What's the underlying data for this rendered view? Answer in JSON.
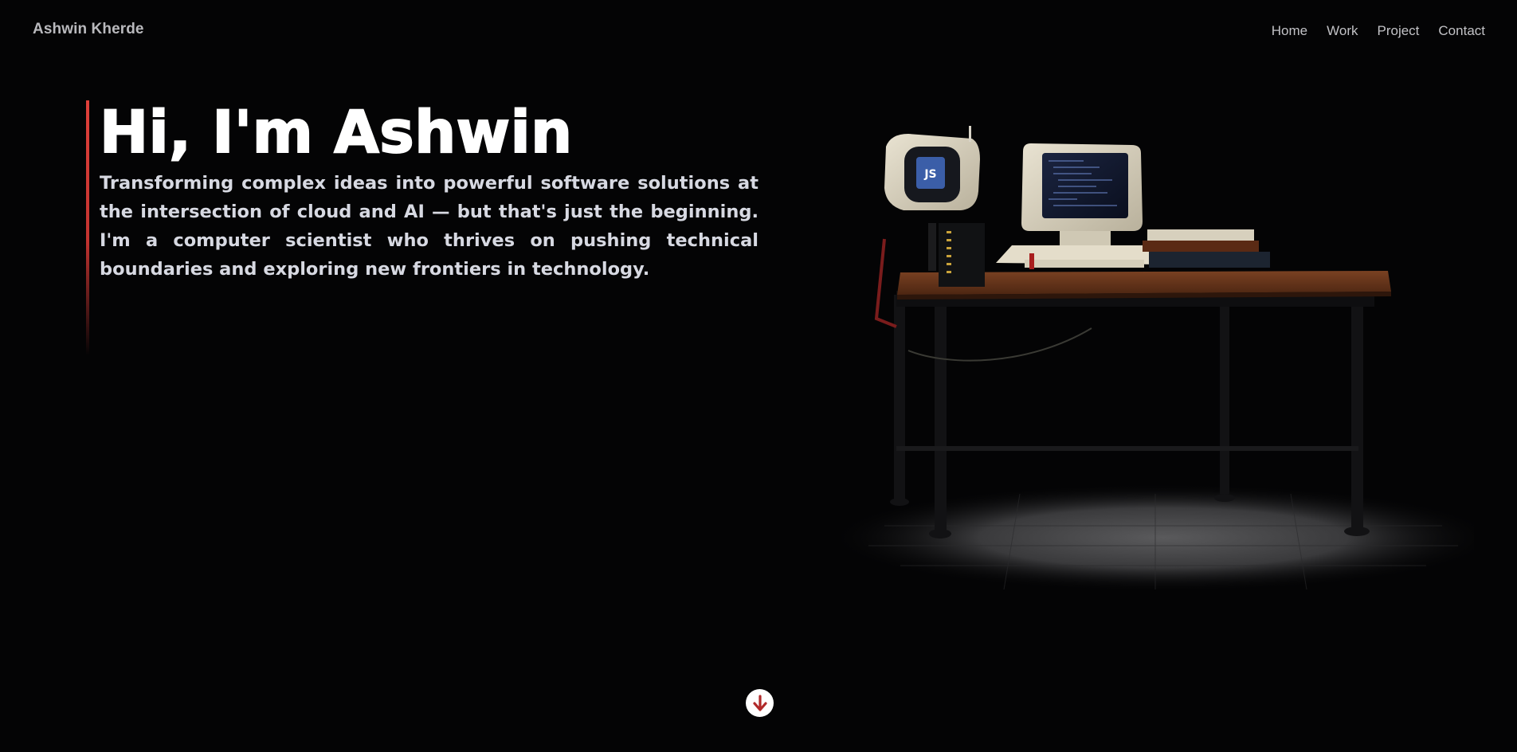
{
  "header": {
    "brand": "Ashwin Kherde",
    "nav": [
      "Home",
      "Work",
      "Project",
      "Contact"
    ]
  },
  "hero": {
    "title": "Hi, I'm Ashwin",
    "subtitle": "Transforming complex ideas into powerful software solutions at the intersection of cloud and AI — but that's just the beginning. I'm a computer scientist who thrives on pushing technical boundaries and exploring new frontiers in technology.",
    "accent_color": "#d23c36"
  },
  "scene": {
    "monitor_logo": "JS"
  },
  "scroll": {
    "icon": "arrow-down-icon",
    "icon_color": "#b12a2a"
  }
}
